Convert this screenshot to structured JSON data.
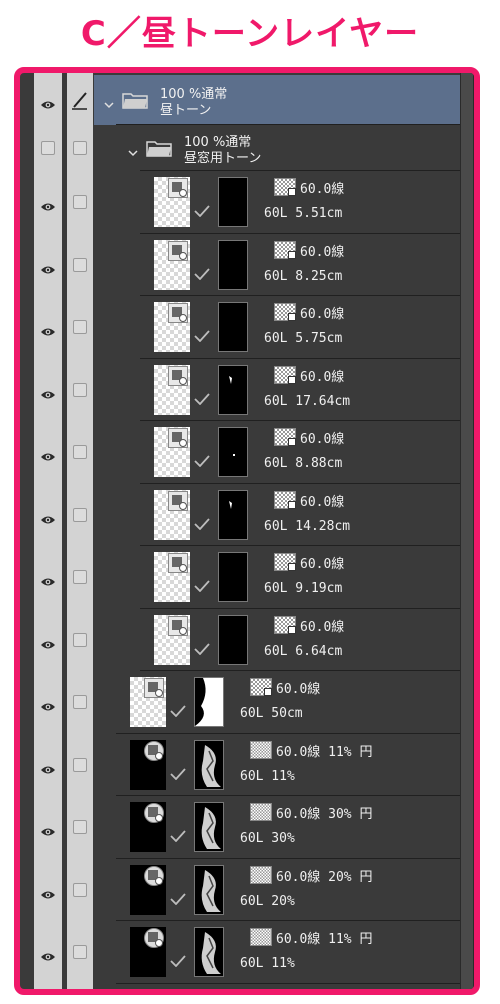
{
  "title": "C／昼トーンレイヤー",
  "folders": [
    {
      "percent": "100 %通常",
      "name": "昼トーン"
    },
    {
      "percent": "100 %通常",
      "name": "昼窓用トーン"
    }
  ],
  "layers": [
    {
      "tone": "60.0線",
      "info": "60L 5.51cm",
      "visible": true
    },
    {
      "tone": "60.0線",
      "info": "60L 8.25cm",
      "visible": true
    },
    {
      "tone": "60.0線",
      "info": "60L 5.75cm",
      "visible": true
    },
    {
      "tone": "60.0線",
      "info": "60L 17.64cm",
      "visible": true
    },
    {
      "tone": "60.0線",
      "info": "60L 8.88cm",
      "visible": true
    },
    {
      "tone": "60.0線",
      "info": "60L 14.28cm",
      "visible": true
    },
    {
      "tone": "60.0線",
      "info": "60L 9.19cm",
      "visible": true
    },
    {
      "tone": "60.0線",
      "info": "60L 6.64cm",
      "visible": true
    },
    {
      "tone": "60.0線",
      "info": "60L 50cm",
      "visible": true
    },
    {
      "tone": "60.0線 11% 円",
      "info": "60L 11%",
      "visible": true
    },
    {
      "tone": "60.0線 30% 円",
      "info": "60L 30%",
      "visible": true
    },
    {
      "tone": "60.0線 20% 円",
      "info": "60L 20%",
      "visible": true
    },
    {
      "tone": "60.0線 11% 円",
      "info": "60L 11%",
      "visible": true
    }
  ],
  "colors": {
    "accent": "#f0196a",
    "panel": "#3a3a3a",
    "selected": "#5c6f8c"
  },
  "icons": {
    "visibility": "eye-icon",
    "edit": "pen-icon",
    "folder": "folder-icon",
    "expand": "chevron-down-icon"
  }
}
